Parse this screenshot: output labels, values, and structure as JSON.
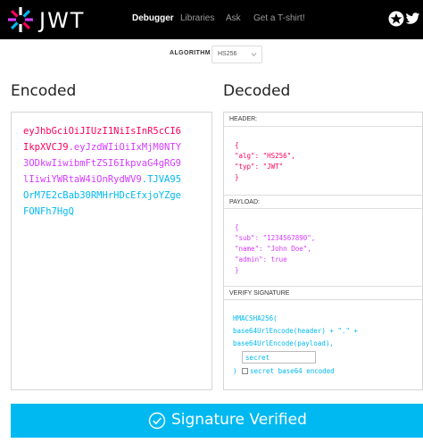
{
  "brand": {
    "name": "JWT"
  },
  "nav": [
    {
      "label": "Debugger",
      "active": true
    },
    {
      "label": "Libraries",
      "active": false
    },
    {
      "label": "Ask",
      "active": false
    },
    {
      "label": "Get a T-shirt!",
      "active": false
    }
  ],
  "top_icons": [
    "auth0-icon",
    "twitter-icon"
  ],
  "algorithm": {
    "label": "ALGORITHM",
    "value": "HS256"
  },
  "encoded": {
    "title": "Encoded",
    "lines": [
      [
        {
          "text": "eyJhbGciOiJIUzI1NiIsInR5cCI6",
          "part": "header"
        }
      ],
      [
        {
          "text": "IkpXVCJ9",
          "part": "header"
        },
        {
          "text": ".",
          "part": "payload"
        },
        {
          "text": "eyJzdWIiOiIxMjM0NTY",
          "part": "payload"
        }
      ],
      [
        {
          "text": "3ODkwIiwibmFtZSI6IkpvaG4gRG9",
          "part": "payload"
        }
      ],
      [
        {
          "text": "lIiwiYWRtaW4iOnRydWV9",
          "part": "payload"
        },
        {
          "text": ".",
          "part": "sig"
        },
        {
          "text": "TJVA95",
          "part": "sig"
        }
      ],
      [
        {
          "text": "OrM7E2cBab30RMHrHDcEfxjoYZge",
          "part": "sig"
        }
      ],
      [
        {
          "text": "FONFh7HgQ",
          "part": "sig"
        }
      ]
    ]
  },
  "decoded": {
    "title": "Decoded",
    "header_label": "HEADER:",
    "header_json": [
      "{",
      "  \"alg\": \"HS256\",",
      "  \"typ\": \"JWT\"",
      "}"
    ],
    "payload_label": "PAYLOAD:",
    "payload_json": [
      "{",
      "  \"sub\": \"1234567890\",",
      "  \"name\": \"John Doe\",",
      "  \"admin\": true",
      "}"
    ],
    "signature_label": "VERIFY SIGNATURE",
    "signature_lines": [
      "HMACSHA256(",
      "  base64UrlEncode(header) + \".\" +",
      "  base64UrlEncode(payload),"
    ],
    "secret_value": "secret",
    "close_paren": ")",
    "base64_label": "secret base64 encoded"
  },
  "status": {
    "label": "Signature Verified"
  },
  "colors": {
    "header": "#fb015b",
    "payload": "#d63aff",
    "signature": "#00b9f1",
    "verified_bg": "#00b9f1",
    "topbar": "#000000"
  }
}
